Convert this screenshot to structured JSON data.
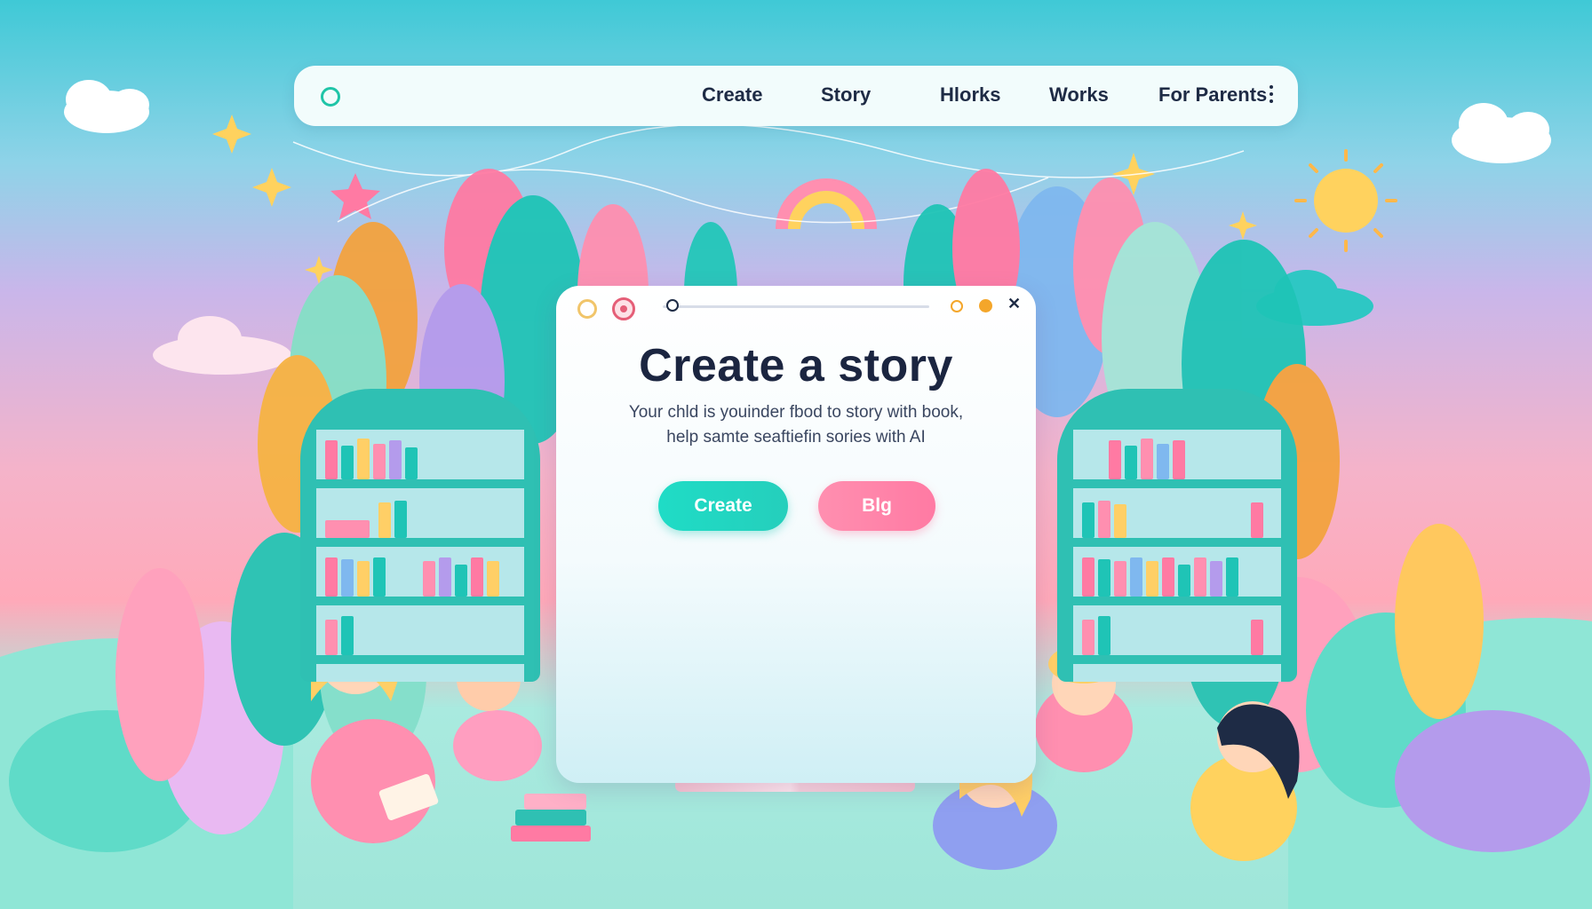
{
  "nav": {
    "items": [
      "Create",
      "Story",
      "Hlorks",
      "Works",
      "For Parents"
    ]
  },
  "card": {
    "title": "Create a story",
    "subtitle_line1": "Your chld is youinder fbod to story with book,",
    "subtitle_line2": "help samte seaftiefin sories with AI",
    "primary_button": "Create",
    "secondary_button": "Blg"
  },
  "colors": {
    "accent_teal": "#20c5a8",
    "accent_pink": "#ff7aa3",
    "text_dark": "#1b2540"
  },
  "icons": {
    "nav_logo": "ring-icon",
    "nav_more": "more-vertical-icon",
    "window_close": "close-icon"
  }
}
